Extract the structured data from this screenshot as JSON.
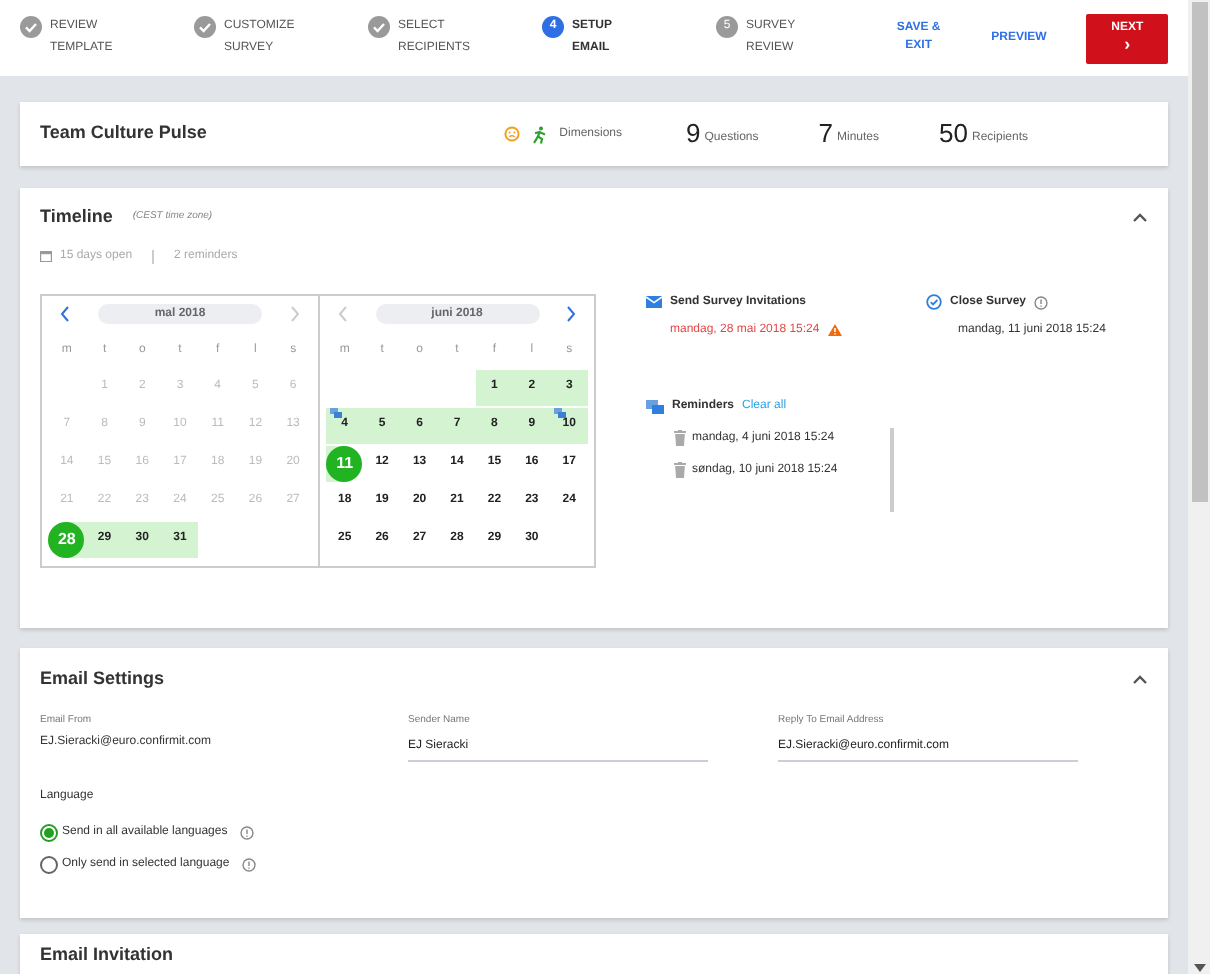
{
  "wizard": {
    "steps": [
      {
        "label": "REVIEW TEMPLATE",
        "done": true,
        "current": false
      },
      {
        "label": "CUSTOMIZE SURVEY",
        "done": true,
        "current": false
      },
      {
        "label": "SELECT RECIPIENTS",
        "done": true,
        "current": false
      },
      {
        "label": "SETUP EMAIL",
        "number": "4",
        "done": false,
        "current": true
      },
      {
        "label": "SURVEY REVIEW",
        "number": "5",
        "done": false,
        "current": false
      }
    ],
    "save_exit": "SAVE & EXIT",
    "preview": "PREVIEW",
    "next": "NEXT",
    "next_icon": "›"
  },
  "summary": {
    "title": "Team Culture Pulse",
    "dimensions_label": "Dimensions",
    "stats": [
      {
        "value": "9",
        "label": "Questions"
      },
      {
        "value": "7",
        "label": "Minutes"
      },
      {
        "value": "50",
        "label": "Recipients"
      }
    ]
  },
  "timeline": {
    "title": "Timeline",
    "timezone": "(CEST time zone)",
    "expanded": true,
    "days_open": "15 days open",
    "reminders_count": "2 reminders",
    "months": [
      {
        "title": "mal 2018",
        "prev_enabled": true,
        "next_enabled": false,
        "weekdays": [
          "m",
          "t",
          "o",
          "t",
          "f",
          "l",
          "s"
        ],
        "weeks": [
          {
            "indented": true,
            "days": [
              {
                "day": "1",
                "kind": "past"
              },
              {
                "day": "2",
                "kind": "past"
              },
              {
                "day": "3",
                "kind": "past"
              },
              {
                "day": "4",
                "kind": "past"
              },
              {
                "day": "5",
                "kind": "past"
              },
              {
                "day": "6",
                "kind": "past"
              }
            ]
          },
          {
            "days": [
              {
                "day": "7",
                "kind": "past"
              },
              {
                "day": "8",
                "kind": "past"
              },
              {
                "day": "9",
                "kind": "past"
              },
              {
                "day": "10",
                "kind": "past"
              },
              {
                "day": "11",
                "kind": "past"
              },
              {
                "day": "12",
                "kind": "past"
              },
              {
                "day": "13",
                "kind": "past"
              }
            ]
          },
          {
            "days": [
              {
                "day": "14",
                "kind": "past"
              },
              {
                "day": "15",
                "kind": "past"
              },
              {
                "day": "16",
                "kind": "past"
              },
              {
                "day": "17",
                "kind": "past"
              },
              {
                "day": "18",
                "kind": "past"
              },
              {
                "day": "19",
                "kind": "past"
              },
              {
                "day": "20",
                "kind": "past"
              }
            ]
          },
          {
            "days": [
              {
                "day": "21",
                "kind": "past"
              },
              {
                "day": "22",
                "kind": "past"
              },
              {
                "day": "23",
                "kind": "past"
              },
              {
                "day": "24",
                "kind": "past"
              },
              {
                "day": "25",
                "kind": "past"
              },
              {
                "day": "26",
                "kind": "past"
              },
              {
                "day": "27",
                "kind": "past"
              }
            ]
          },
          {
            "indented": false,
            "days": [
              {
                "day": "28",
                "kind": "start"
              },
              {
                "day": "29",
                "kind": "range"
              },
              {
                "day": "30",
                "kind": "range"
              },
              {
                "day": "31",
                "kind": "range"
              }
            ]
          }
        ]
      },
      {
        "title": "juni 2018",
        "prev_enabled": false,
        "next_enabled": true,
        "weekdays": [
          "m",
          "t",
          "o",
          "t",
          "f",
          "l",
          "s"
        ],
        "weeks": [
          {
            "indented": true,
            "days": [
              {
                "day": "1",
                "kind": "range"
              },
              {
                "day": "2",
                "kind": "range"
              },
              {
                "day": "3",
                "kind": "range"
              }
            ]
          },
          {
            "days": [
              {
                "day": "4",
                "kind": "range",
                "reminder": true
              },
              {
                "day": "5",
                "kind": "range"
              },
              {
                "day": "6",
                "kind": "range"
              },
              {
                "day": "7",
                "kind": "range"
              },
              {
                "day": "8",
                "kind": "range"
              },
              {
                "day": "9",
                "kind": "range"
              },
              {
                "day": "10",
                "kind": "range",
                "reminder": true
              }
            ]
          },
          {
            "days": [
              {
                "day": "11",
                "kind": "end"
              },
              {
                "day": "12",
                "kind": "normal"
              },
              {
                "day": "13",
                "kind": "normal"
              },
              {
                "day": "14",
                "kind": "normal"
              },
              {
                "day": "15",
                "kind": "normal"
              },
              {
                "day": "16",
                "kind": "normal"
              },
              {
                "day": "17",
                "kind": "normal"
              }
            ]
          },
          {
            "days": [
              {
                "day": "18",
                "kind": "normal"
              },
              {
                "day": "19",
                "kind": "normal"
              },
              {
                "day": "20",
                "kind": "normal"
              },
              {
                "day": "21",
                "kind": "normal"
              },
              {
                "day": "22",
                "kind": "normal"
              },
              {
                "day": "23",
                "kind": "normal"
              },
              {
                "day": "24",
                "kind": "normal"
              }
            ]
          },
          {
            "indented": false,
            "days": [
              {
                "day": "25",
                "kind": "normal"
              },
              {
                "day": "26",
                "kind": "normal"
              },
              {
                "day": "27",
                "kind": "normal"
              },
              {
                "day": "28",
                "kind": "normal"
              },
              {
                "day": "29",
                "kind": "normal"
              },
              {
                "day": "30",
                "kind": "normal"
              }
            ]
          }
        ]
      }
    ],
    "send": {
      "title": "Send Survey Invitations",
      "date": "mandag, 28 mai 2018 15:24",
      "warning": true
    },
    "close": {
      "title": "Close Survey",
      "date": "mandag, 11 juni 2018 15:24"
    },
    "reminders": {
      "title": "Reminders",
      "clear": "Clear all",
      "items": [
        "mandag, 4 juni 2018 15:24",
        "søndag, 10 juni 2018 15:24"
      ]
    }
  },
  "email_settings": {
    "title": "Email Settings",
    "expanded": true,
    "email_from": {
      "label": "Email From",
      "value": "EJ.Sieracki@euro.confirmit.com"
    },
    "sender_name": {
      "label": "Sender Name",
      "value": "EJ Sieracki"
    },
    "reply_to": {
      "label": "Reply To Email Address",
      "value": "EJ.Sieracki@euro.confirmit.com"
    },
    "language_label": "Language",
    "language_options": [
      {
        "label": "Send in all available languages",
        "selected": true
      },
      {
        "label": "Only send in selected language",
        "selected": false
      }
    ]
  },
  "email_invitation": {
    "title": "Email Invitation"
  }
}
